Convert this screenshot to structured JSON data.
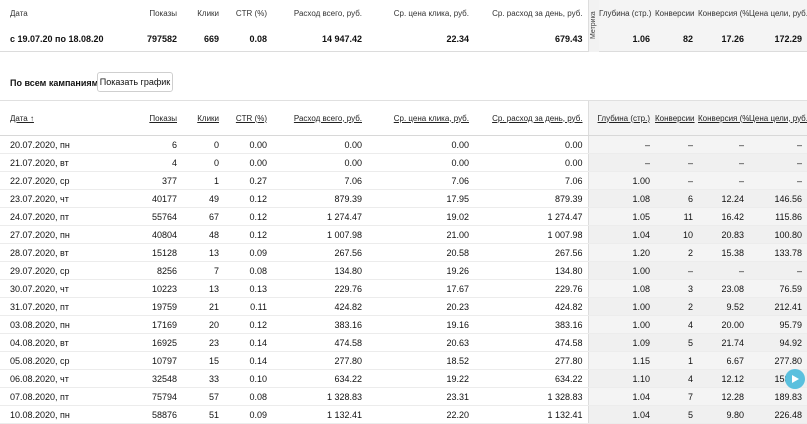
{
  "summary": {
    "headers": {
      "date": "Дата",
      "shows": "Показы",
      "clicks": "Клики",
      "ctr": "CTR (%)",
      "spend": "Расход всего, руб.",
      "cpc": "Ср. цена клика, руб.",
      "daily": "Ср. расход за день, руб.",
      "metrika": "Метрика",
      "depth": "Глубина (стр.)",
      "conv": "Конверсии",
      "conv_pct": "Конверсия (%)",
      "goal_price": "Цена цели, руб."
    },
    "totals": {
      "period": "с 19.07.20 по 18.08.20",
      "shows": "797582",
      "clicks": "669",
      "ctr": "0.08",
      "spend": "14 947.42",
      "cpc": "22.34",
      "daily": "679.43",
      "depth": "1.06",
      "conv": "82",
      "conv_pct": "17.26",
      "goal_price": "172.29"
    }
  },
  "campaigns": {
    "label": "По всем кампаниям",
    "graph_button": "Показать график"
  },
  "table": {
    "headers": {
      "date": "Дата ↑",
      "shows": "Показы",
      "clicks": "Клики",
      "ctr": "CTR (%)",
      "spend": "Расход всего, руб.",
      "cpc": "Ср. цена клика, руб.",
      "daily": "Ср. расход за день, руб.",
      "depth": "Глубина (стр.)",
      "conv": "Конверсии",
      "conv_pct": "Конверсия (%)",
      "goal_price": "Цена цели, руб."
    },
    "rows": [
      [
        "20.07.2020, пн",
        "6",
        "0",
        "0.00",
        "0.00",
        "0.00",
        "0.00",
        "–",
        "–",
        "–",
        "–"
      ],
      [
        "21.07.2020, вт",
        "4",
        "0",
        "0.00",
        "0.00",
        "0.00",
        "0.00",
        "–",
        "–",
        "–",
        "–"
      ],
      [
        "22.07.2020, ср",
        "377",
        "1",
        "0.27",
        "7.06",
        "7.06",
        "7.06",
        "1.00",
        "–",
        "–",
        "–"
      ],
      [
        "23.07.2020, чт",
        "40177",
        "49",
        "0.12",
        "879.39",
        "17.95",
        "879.39",
        "1.08",
        "6",
        "12.24",
        "146.56"
      ],
      [
        "24.07.2020, пт",
        "55764",
        "67",
        "0.12",
        "1 274.47",
        "19.02",
        "1 274.47",
        "1.05",
        "11",
        "16.42",
        "115.86"
      ],
      [
        "27.07.2020, пн",
        "40804",
        "48",
        "0.12",
        "1 007.98",
        "21.00",
        "1 007.98",
        "1.04",
        "10",
        "20.83",
        "100.80"
      ],
      [
        "28.07.2020, вт",
        "15128",
        "13",
        "0.09",
        "267.56",
        "20.58",
        "267.56",
        "1.20",
        "2",
        "15.38",
        "133.78"
      ],
      [
        "29.07.2020, ср",
        "8256",
        "7",
        "0.08",
        "134.80",
        "19.26",
        "134.80",
        "1.00",
        "–",
        "–",
        "–"
      ],
      [
        "30.07.2020, чт",
        "10223",
        "13",
        "0.13",
        "229.76",
        "17.67",
        "229.76",
        "1.08",
        "3",
        "23.08",
        "76.59"
      ],
      [
        "31.07.2020, пт",
        "19759",
        "21",
        "0.11",
        "424.82",
        "20.23",
        "424.82",
        "1.00",
        "2",
        "9.52",
        "212.41"
      ],
      [
        "03.08.2020, пн",
        "17169",
        "20",
        "0.12",
        "383.16",
        "19.16",
        "383.16",
        "1.00",
        "4",
        "20.00",
        "95.79"
      ],
      [
        "04.08.2020, вт",
        "16925",
        "23",
        "0.14",
        "474.58",
        "20.63",
        "474.58",
        "1.09",
        "5",
        "21.74",
        "94.92"
      ],
      [
        "05.08.2020, ср",
        "10797",
        "15",
        "0.14",
        "277.80",
        "18.52",
        "277.80",
        "1.15",
        "1",
        "6.67",
        "277.80"
      ],
      [
        "06.08.2020, чт",
        "32548",
        "33",
        "0.10",
        "634.22",
        "19.22",
        "634.22",
        "1.10",
        "4",
        "12.12",
        "158.56"
      ],
      [
        "07.08.2020, пт",
        "75794",
        "57",
        "0.08",
        "1 328.83",
        "23.31",
        "1 328.83",
        "1.04",
        "7",
        "12.28",
        "189.83"
      ],
      [
        "10.08.2020, пн",
        "58876",
        "51",
        "0.09",
        "1 132.41",
        "22.20",
        "1 132.41",
        "1.04",
        "5",
        "9.80",
        "226.48"
      ]
    ]
  }
}
